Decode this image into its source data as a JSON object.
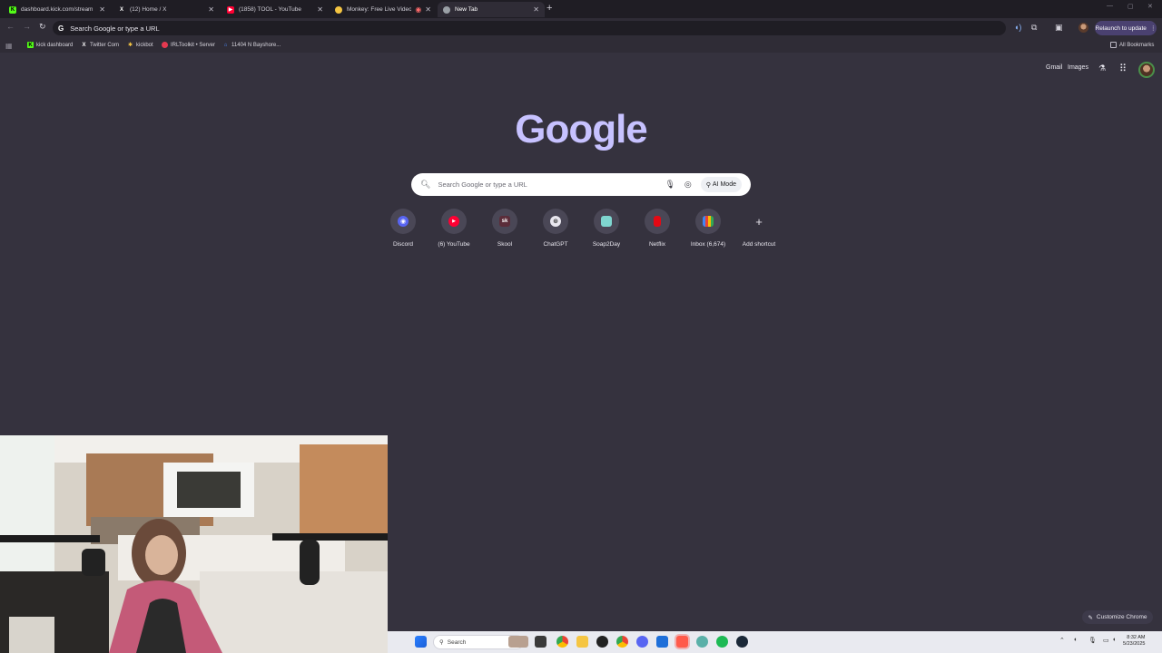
{
  "tabs": [
    {
      "title": "dashboard.kick.com/stream",
      "favicon": "kick-icon",
      "color": "#53fc18",
      "glyph": "K",
      "active": false
    },
    {
      "title": "(12) Home / X",
      "favicon": "x-icon",
      "color": "#ffffff",
      "glyph": "X",
      "active": false
    },
    {
      "title": "(1858) TOOL - YouTube",
      "favicon": "youtube-icon",
      "color": "#ff0033",
      "glyph": "▶",
      "active": false
    },
    {
      "title": "Monkey: Free Live Video Ch",
      "favicon": "monkey-icon",
      "color": "#f5c542",
      "glyph": "●",
      "active": false
    },
    {
      "title": "New Tab",
      "favicon": "chrome-icon",
      "color": "#9aa0a6",
      "glyph": "●",
      "active": true
    }
  ],
  "toolbar": {
    "omnibox_text": "Search Google or type a URL",
    "relaunch_label": "Relaunch to update"
  },
  "bookmarks": [
    {
      "label": "kick dashboard",
      "icon": "kick-icon",
      "color": "#53fc18",
      "glyph": "K"
    },
    {
      "label": "Twitter Com",
      "icon": "x-icon",
      "color": "#ffffff",
      "glyph": "X"
    },
    {
      "label": "kickbot",
      "icon": "kickbot-icon",
      "color": "#f5c542",
      "glyph": "k"
    },
    {
      "label": "IRLToolkit • Server",
      "icon": "irltoolkit-icon",
      "color": "#e53950",
      "glyph": "I"
    },
    {
      "label": "11404 N Bayshore...",
      "icon": "house-icon",
      "color": "#4a8cff",
      "glyph": "⌂"
    }
  ],
  "all_bookmarks": "All Bookmarks",
  "header": {
    "gmail": "Gmail",
    "images": "Images"
  },
  "logo": "Google",
  "search": {
    "placeholder": "Search Google or type a URL",
    "ai_mode": "AI Mode"
  },
  "shortcuts": [
    {
      "label": "Discord",
      "icon": "discord-icon",
      "color": "#5865f2",
      "glyph": "◉"
    },
    {
      "label": "(6) YouTube",
      "icon": "youtube-icon",
      "color": "#ff0033",
      "glyph": "▶"
    },
    {
      "label": "Skool",
      "icon": "skool-icon",
      "color": "#5b2d3a",
      "glyph": "sk"
    },
    {
      "label": "ChatGPT",
      "icon": "chatgpt-icon",
      "color": "#6b6b73",
      "glyph": "⊛"
    },
    {
      "label": "Soap2Day",
      "icon": "soap2day-icon",
      "color": "#7fd6d0",
      "glyph": "▣"
    },
    {
      "label": "Netflix",
      "icon": "netflix-icon",
      "color": "#e50914",
      "glyph": "N"
    },
    {
      "label": "Inbox (6,674)",
      "icon": "gmail-icon",
      "color": "#ea4335",
      "glyph": "M"
    },
    {
      "label": "Add shortcut",
      "icon": "plus-icon",
      "color": "#4a4756",
      "glyph": "+"
    }
  ],
  "customize_label": "Customize Chrome",
  "taskbar": {
    "search_label": "Search",
    "time": "8:32 AM",
    "date": "5/23/2025"
  }
}
